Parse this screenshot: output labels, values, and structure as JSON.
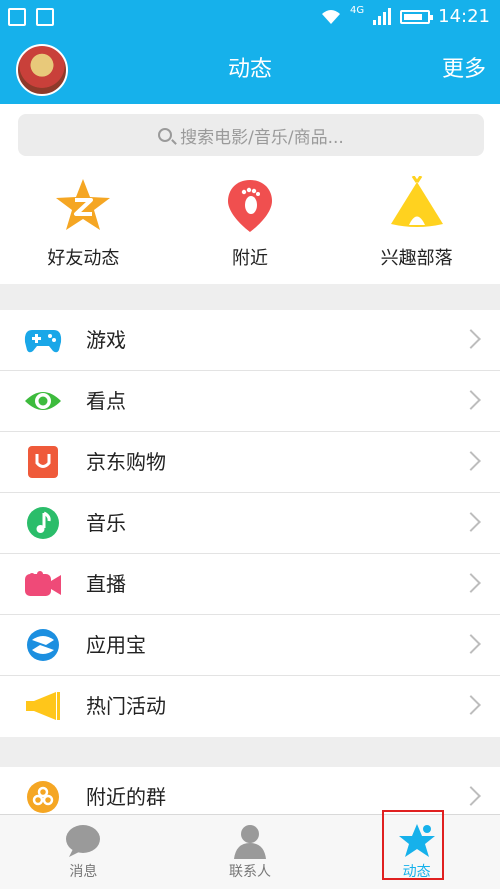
{
  "statusbar": {
    "network": "4G",
    "time": "14:21",
    "battery_fraction": 0.8
  },
  "header": {
    "title": "动态",
    "more_label": "更多"
  },
  "search": {
    "placeholder": "搜索电影/音乐/商品..."
  },
  "quick": [
    {
      "label": "好友动态",
      "icon": "star-z-icon"
    },
    {
      "label": "附近",
      "icon": "location-footprint-icon"
    },
    {
      "label": "兴趣部落",
      "icon": "tent-icon"
    }
  ],
  "menu": [
    {
      "label": "游戏",
      "icon": "gamepad-icon"
    },
    {
      "label": "看点",
      "icon": "eye-icon"
    },
    {
      "label": "京东购物",
      "icon": "shopping-bag-icon"
    },
    {
      "label": "音乐",
      "icon": "music-note-icon"
    },
    {
      "label": "直播",
      "icon": "video-camera-icon"
    },
    {
      "label": "应用宝",
      "icon": "app-store-icon"
    },
    {
      "label": "热门活动",
      "icon": "megaphone-icon"
    }
  ],
  "menu2": [
    {
      "label": "附近的群",
      "icon": "group-icon"
    }
  ],
  "tabs": [
    {
      "label": "消息",
      "icon": "chat-bubble-icon"
    },
    {
      "label": "联系人",
      "icon": "person-icon"
    },
    {
      "label": "动态",
      "icon": "star-icon"
    }
  ],
  "colors": {
    "brand": "#16b1eb",
    "highlight_box": "#e02020"
  }
}
